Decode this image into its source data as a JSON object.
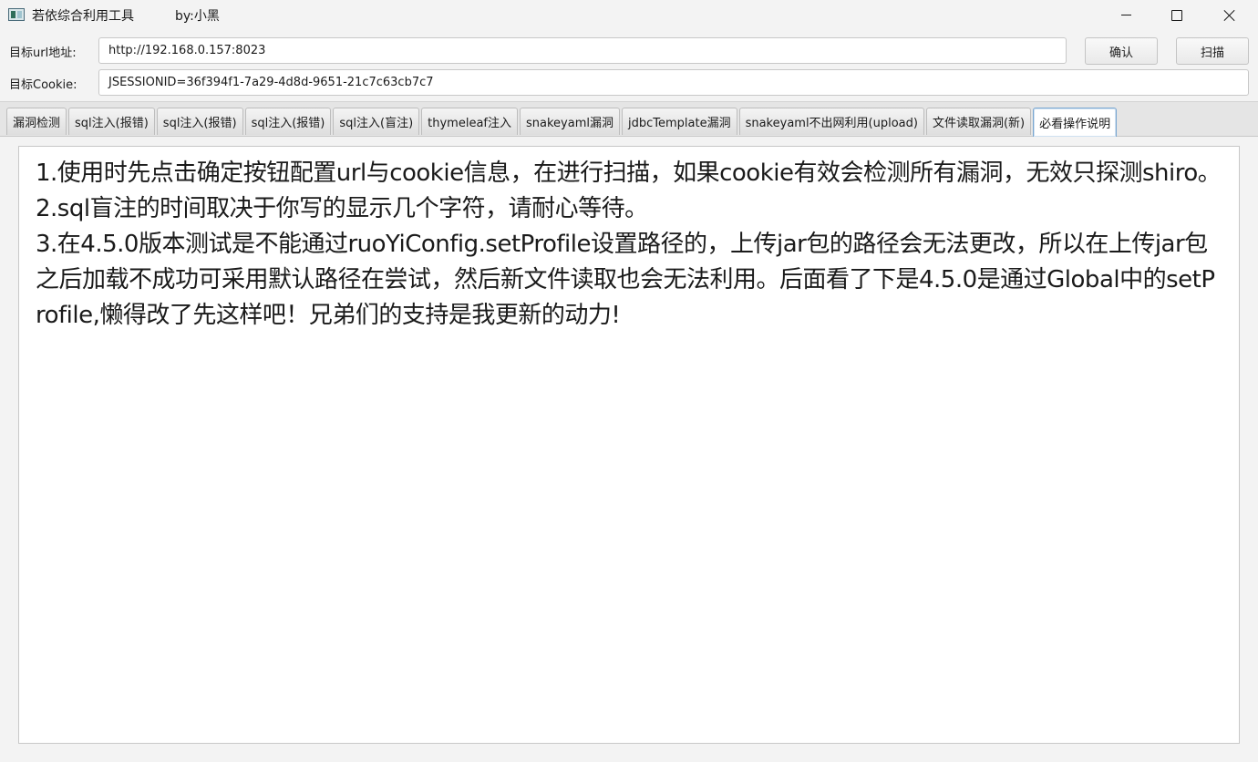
{
  "window": {
    "title": "若依综合利用工具",
    "author": "by:小黑"
  },
  "form": {
    "url_label": "目标url地址:",
    "url_value": "http://192.168.0.157:8023",
    "cookie_label": "目标Cookie:",
    "cookie_value": "JSESSIONID=36f394f1-7a29-4d8d-9651-21c7c63cb7c7",
    "confirm_label": "确认",
    "scan_label": "扫描"
  },
  "tabs": [
    {
      "label": "漏洞检测"
    },
    {
      "label": "sql注入(报错)"
    },
    {
      "label": "sql注入(报错)"
    },
    {
      "label": "sql注入(报错)"
    },
    {
      "label": "sql注入(盲注)"
    },
    {
      "label": "thymeleaf注入"
    },
    {
      "label": "snakeyaml漏洞"
    },
    {
      "label": "jdbcTemplate漏洞"
    },
    {
      "label": "snakeyaml不出网利用(upload)"
    },
    {
      "label": "文件读取漏洞(新)"
    },
    {
      "label": "必看操作说明",
      "active": true
    }
  ],
  "content": {
    "lines": [
      "1.使用时先点击确定按钮配置url与cookie信息，在进行扫描，如果cookie有效会检测所有漏洞，无效只探测shiro。",
      "2.sql盲注的时间取决于你写的显示几个字符，请耐心等待。",
      "3.在4.5.0版本测试是不能通过ruoYiConfig.setProfile设置路径的，上传jar包的路径会无法更改，所以在上传jar包之后加载不成功可采用默认路径在尝试，然后新文件读取也会无法利用。后面看了下是4.5.0是通过Global中的setProfile,懒得改了先这样吧！兄弟们的支持是我更新的动力!"
    ]
  }
}
